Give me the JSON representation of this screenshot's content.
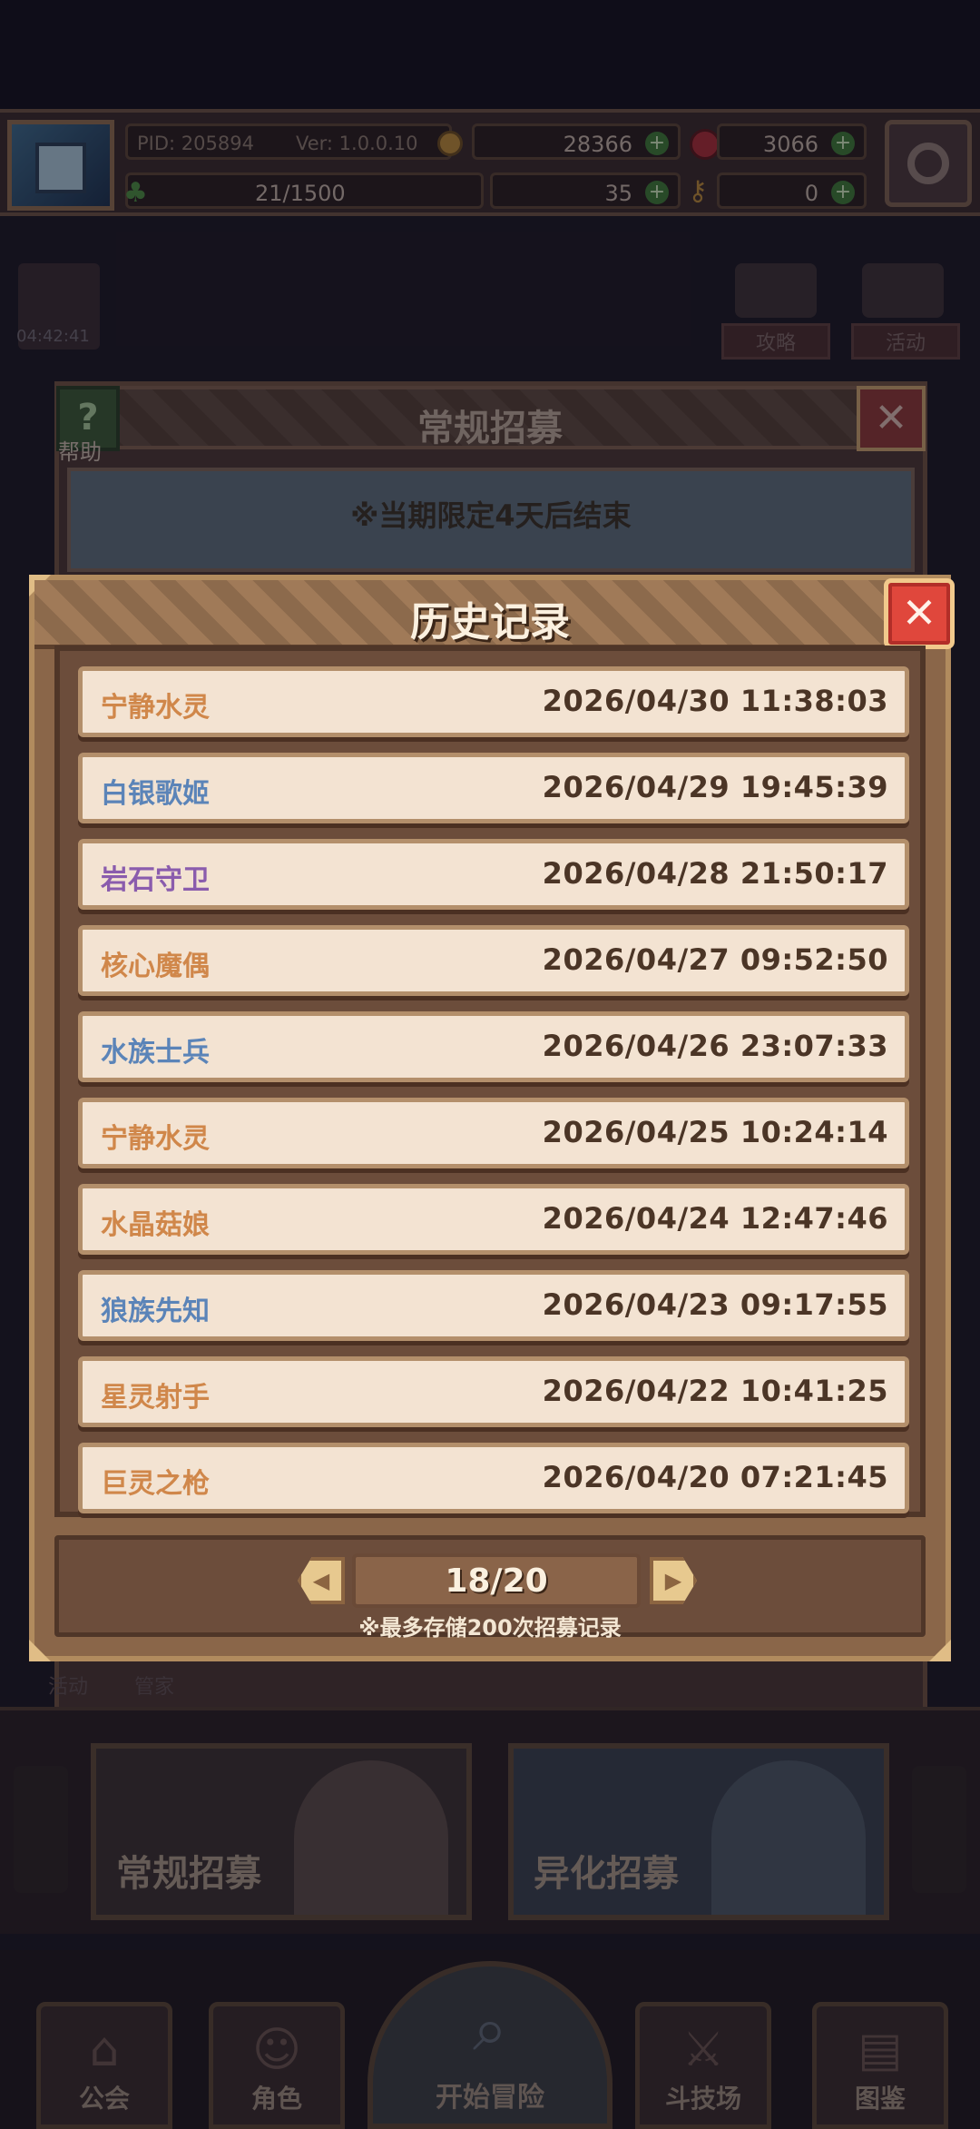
{
  "status": {
    "pid_label": "PID: 205894",
    "version_label": "Ver: 1.0.0.10",
    "gold": "28366",
    "gems": "3066",
    "exp": "21/1500",
    "clover": "35",
    "keys": "0"
  },
  "background": {
    "timer": "04:42:41",
    "strategy_label": "攻略",
    "event_label": "活动",
    "help_label": "帮助",
    "recruit_title": "常规招募",
    "limited_notice": "※当期限定4天后结束",
    "tab_a": "活动",
    "tab_b": "管家",
    "card_normal": "常规招募",
    "card_alien": "异化招募"
  },
  "nav": {
    "guild": "公会",
    "character": "角色",
    "adventure": "开始冒险",
    "arena": "斗技场",
    "codex": "图鉴"
  },
  "modal": {
    "title": "历史记录",
    "close_icon": "close-icon",
    "page": "18/20",
    "note": "※最多存储200次招募记录",
    "records": [
      {
        "name": "宁静水灵",
        "time": "2026/04/30 11:38:03",
        "color": "#d0874a"
      },
      {
        "name": "白银歌姬",
        "time": "2026/04/29 19:45:39",
        "color": "#5b84b8"
      },
      {
        "name": "岩石守卫",
        "time": "2026/04/28 21:50:17",
        "color": "#8a5cad"
      },
      {
        "name": "核心魔偶",
        "time": "2026/04/27 09:52:50",
        "color": "#d0874a"
      },
      {
        "name": "水族士兵",
        "time": "2026/04/26 23:07:33",
        "color": "#5b84b8"
      },
      {
        "name": "宁静水灵",
        "time": "2026/04/25 10:24:14",
        "color": "#d0874a"
      },
      {
        "name": "水晶菇娘",
        "time": "2026/04/24 12:47:46",
        "color": "#d0874a"
      },
      {
        "name": "狼族先知",
        "time": "2026/04/23 09:17:55",
        "color": "#5b84b8"
      },
      {
        "name": "星灵射手",
        "time": "2026/04/22 10:41:25",
        "color": "#d0874a"
      },
      {
        "name": "巨灵之枪",
        "time": "2026/04/20 07:21:45",
        "color": "#d0874a"
      }
    ]
  }
}
